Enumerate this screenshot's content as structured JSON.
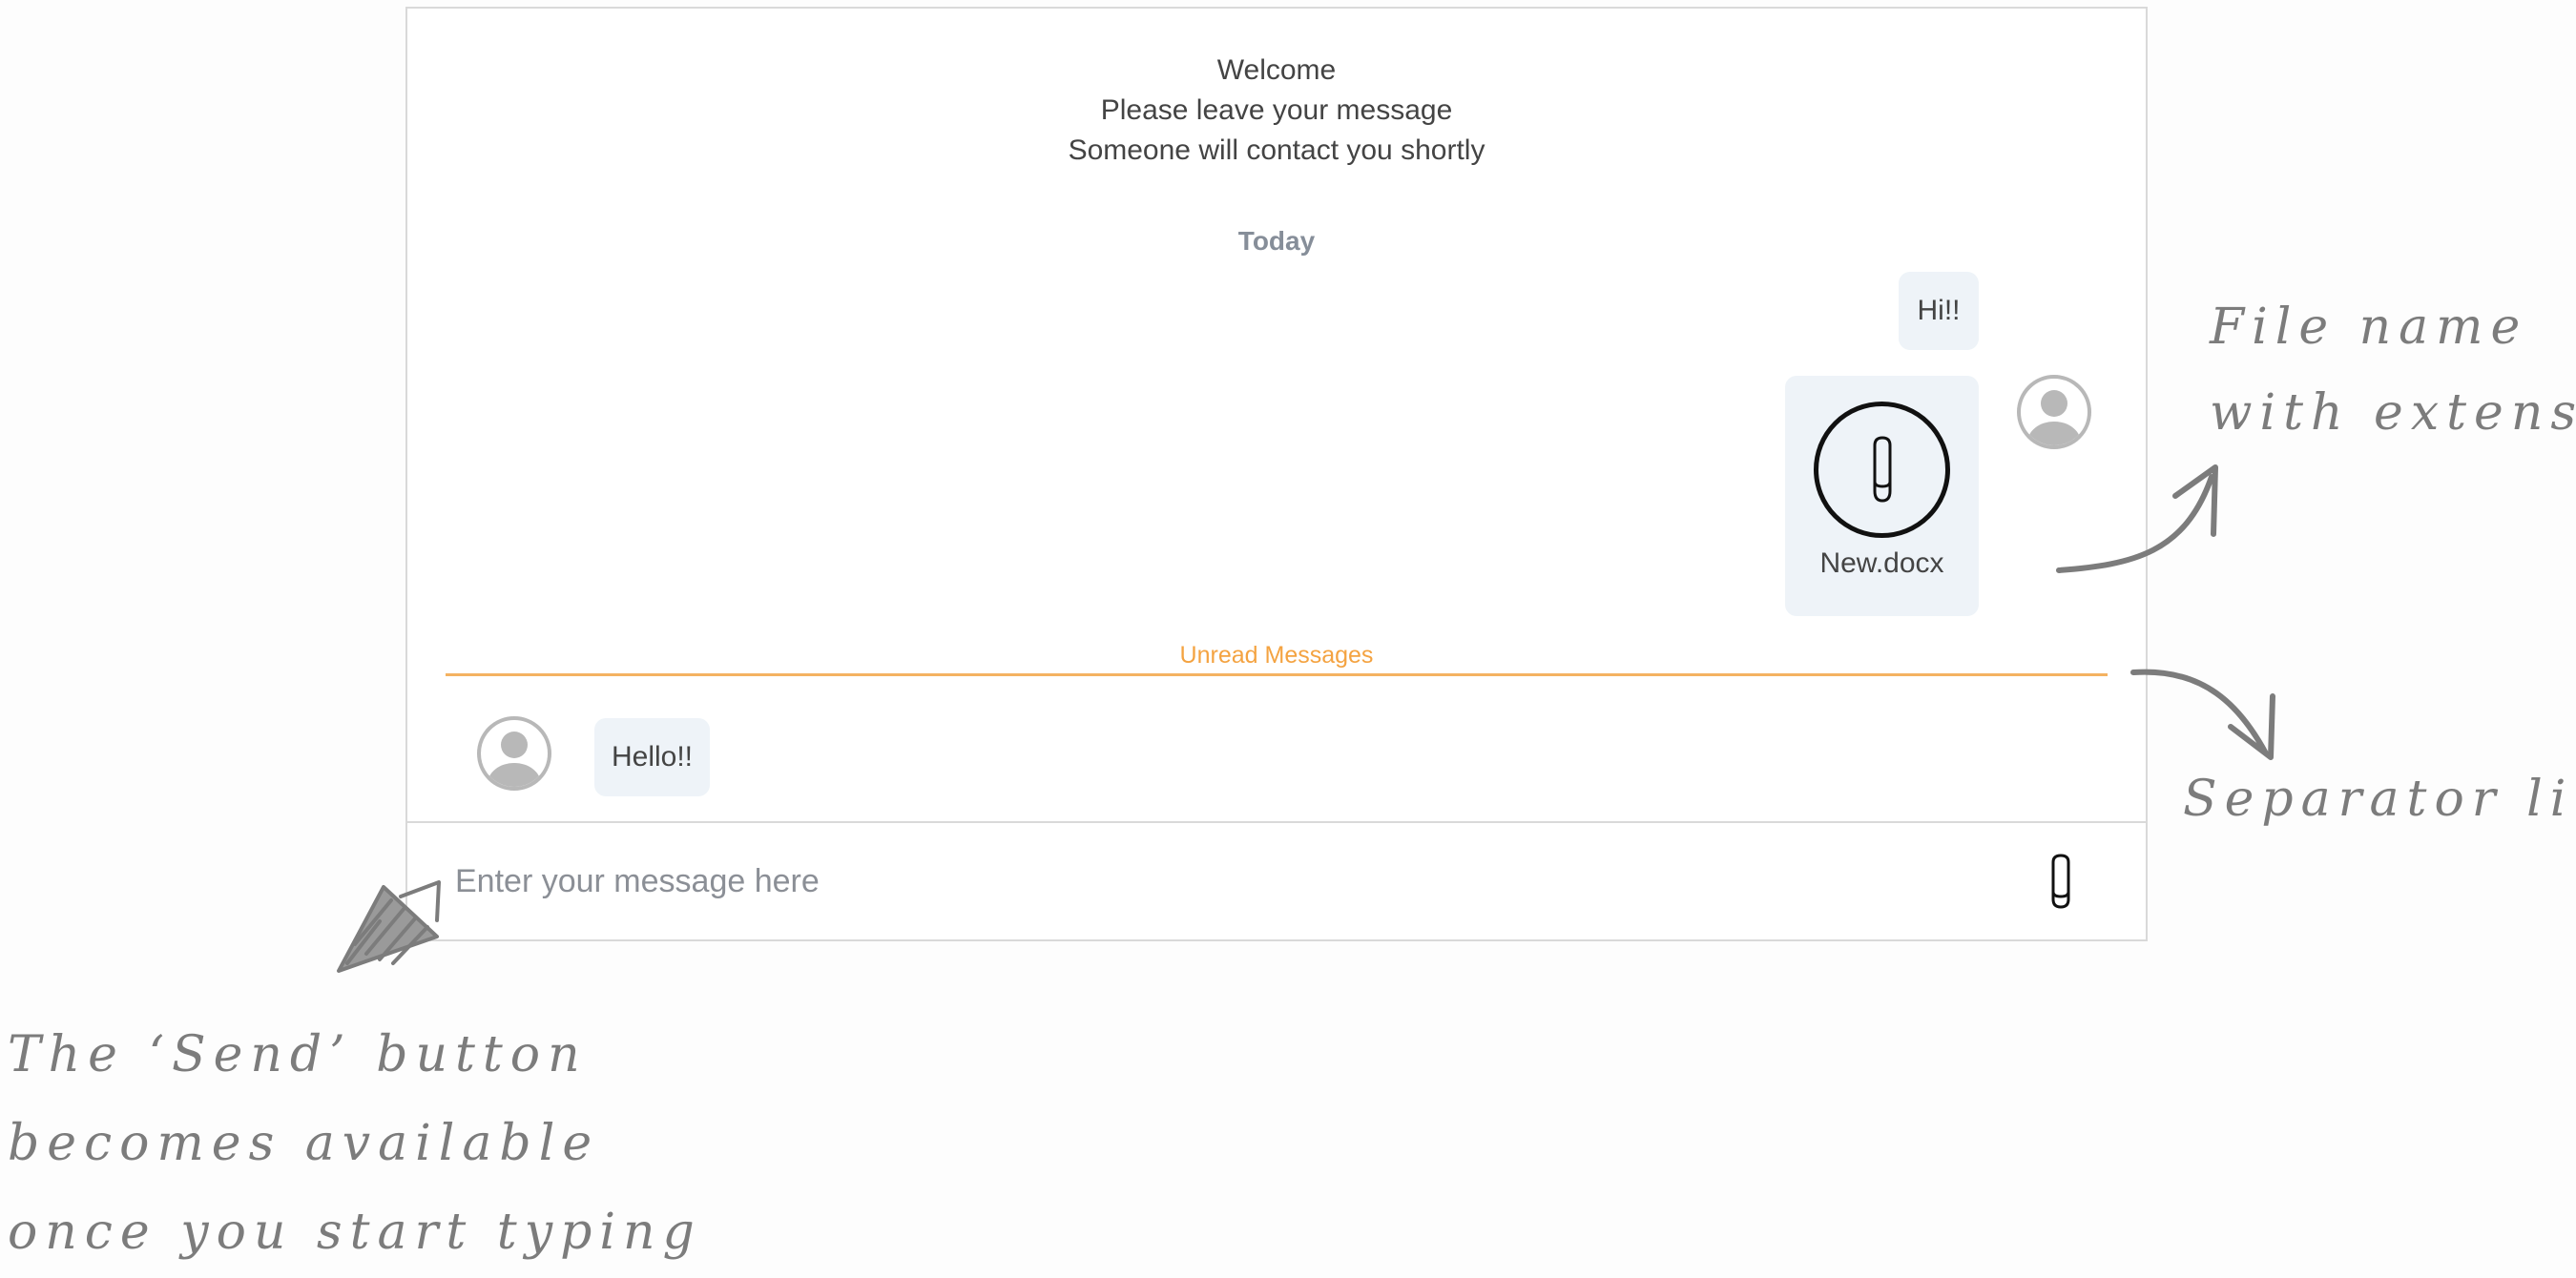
{
  "welcome": {
    "line1": "Welcome",
    "line2": "Please leave your message",
    "line3": "Someone will contact you shortly"
  },
  "date_separator": "Today",
  "messages": {
    "outgoing_text": "Hi!!",
    "outgoing_file_name": "New.docx",
    "incoming_text": "Hello!!"
  },
  "unread_label": "Unread Messages",
  "composer": {
    "placeholder": "Enter your message here"
  },
  "annotations": {
    "file": {
      "line1": "File name",
      "line2": "with extension"
    },
    "separator": "Separator line",
    "send": {
      "line1": "The ‘Send’ button",
      "line2": "becomes available",
      "line3": "once you start typing"
    }
  },
  "icons": [
    "paperclip-icon",
    "user-avatar-icon",
    "arrow-icon"
  ],
  "colors": {
    "unread_accent": "#f4a341",
    "bubble_bg": "#eef3f8",
    "annotation": "#7c7c7c",
    "muted_text": "#868e99"
  }
}
